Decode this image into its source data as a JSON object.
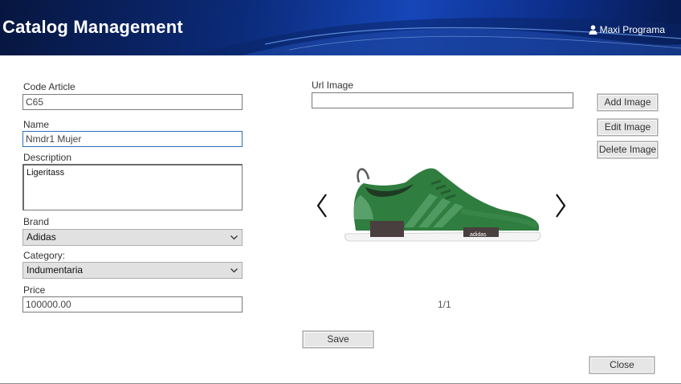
{
  "header": {
    "title": "Catalog Management",
    "user_icon": "user-icon",
    "user_name": "Maxi Programa"
  },
  "form": {
    "code_label": "Code Article",
    "code_value": "C65",
    "name_label": "Name",
    "name_value": "Nmdr1 Mujer",
    "description_label": "Description",
    "description_value": "Ligeritass",
    "brand_label": "Brand",
    "brand_value": "Adidas",
    "category_label": "Category:",
    "category_value": "Indumentaria",
    "price_label": "Price",
    "price_value": "100000.00"
  },
  "image_panel": {
    "url_label": "Url Image",
    "url_value": "",
    "add_label": "Add Image",
    "edit_label": "Edit Image",
    "delete_label": "Delete Image",
    "counter": "1/1",
    "shoe_brand_text": "adidas"
  },
  "actions": {
    "save_label": "Save",
    "close_label": "Close"
  },
  "colors": {
    "header_dark": "#07163f",
    "header_light": "#1646b8",
    "focus_border": "#2b6fb6",
    "shoe_green": "#2f7d3f"
  }
}
